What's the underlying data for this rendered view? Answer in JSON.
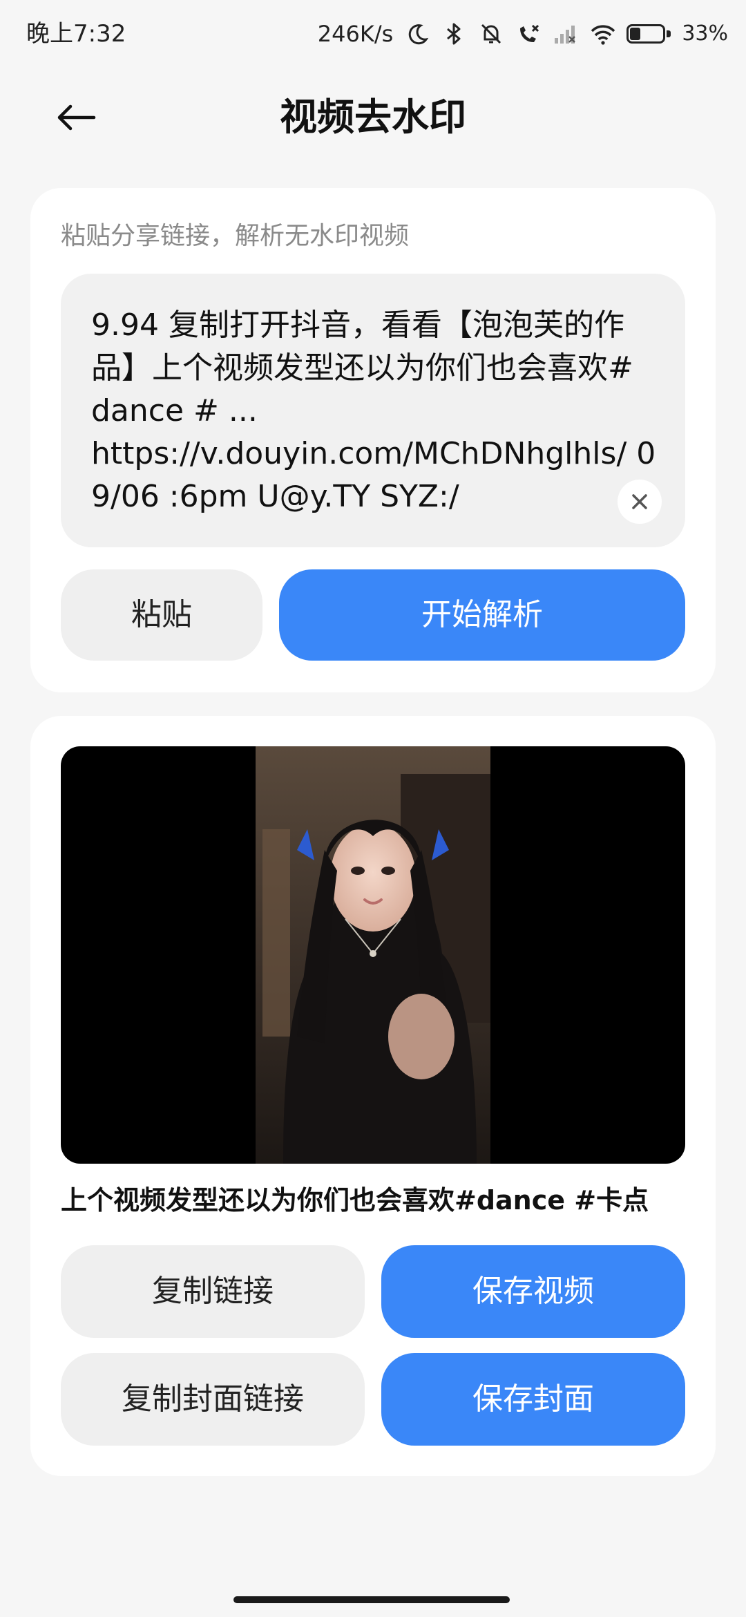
{
  "status_bar": {
    "time": "晚上7:32",
    "network_speed": "246K/s",
    "battery_percent": "33%",
    "battery_level": 0.33,
    "icons": [
      "moon-icon",
      "bluetooth-icon",
      "bell-off-icon",
      "call-missed-icon",
      "signal-icon",
      "wifi-icon",
      "battery-icon"
    ]
  },
  "header": {
    "back_icon": "arrow-left-icon",
    "title": "视频去水印"
  },
  "input_card": {
    "hint": "粘贴分享链接，解析无水印视频",
    "link_text": "9.94 复制打开抖音，看看【泡泡芙的作品】上个视频发型还以为你们也会喜欢# dance # ...\nhttps://v.douyin.com/MChDNhglhls/ 09/06 :6pm U@y.TY SYZ:/",
    "clear_icon": "close-icon",
    "paste_label": "粘贴",
    "parse_label": "开始解析"
  },
  "result_card": {
    "caption": "上个视频发型还以为你们也会喜欢#dance #卡点",
    "copy_link_label": "复制链接",
    "save_video_label": "保存视频",
    "copy_cover_label": "复制封面链接",
    "save_cover_label": "保存封面"
  },
  "colors": {
    "accent": "#3a87f8",
    "background": "#f6f6f6",
    "card": "#ffffff",
    "secondary_button": "#efefef"
  }
}
